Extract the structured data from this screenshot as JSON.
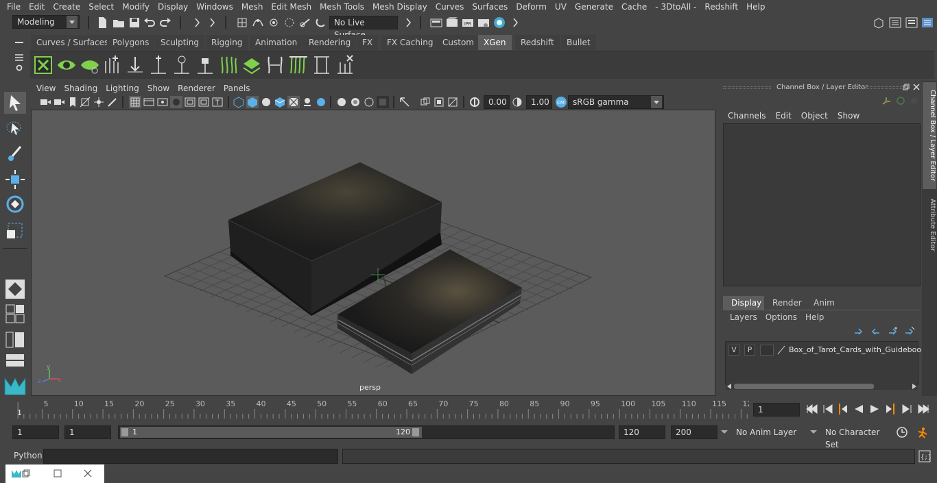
{
  "menubar": {
    "items": [
      "File",
      "Edit",
      "Create",
      "Select",
      "Modify",
      "Display",
      "Windows",
      "Mesh",
      "Edit Mesh",
      "Mesh Tools",
      "Mesh Display",
      "Curves",
      "Surfaces",
      "Deform",
      "UV",
      "Generate",
      "Cache",
      "- 3DtoAll -",
      "Redshift",
      "Help"
    ]
  },
  "status": {
    "mode": "Modeling",
    "live_surface": "No Live Surface"
  },
  "shelf": {
    "tabs": [
      "Curves / Surfaces",
      "Polygons",
      "Sculpting",
      "Rigging",
      "Animation",
      "Rendering",
      "FX",
      "FX Caching",
      "Custom",
      "XGen",
      "Redshift",
      "Bullet"
    ],
    "active_tab": "XGen"
  },
  "panel_menu": [
    "View",
    "Shading",
    "Lighting",
    "Show",
    "Renderer",
    "Panels"
  ],
  "view_tools": {
    "exposure": "0.00",
    "gamma": "1.00",
    "color_space": "sRGB gamma"
  },
  "viewport": {
    "camera_label": "persp",
    "axis_x": "x",
    "axis_y": "y",
    "axis_z": "z"
  },
  "channel_box": {
    "title": "Channel Box / Layer Editor",
    "menu": [
      "Channels",
      "Edit",
      "Object",
      "Show"
    ],
    "layer_tabs": [
      "Display",
      "Render",
      "Anim"
    ],
    "active_layer_tab": "Display",
    "layer_menu": [
      "Layers",
      "Options",
      "Help"
    ],
    "layer": {
      "v": "V",
      "p": "P",
      "name": "Box_of_Tarot_Cards_with_Guidebook"
    }
  },
  "side_tabs": [
    "Channel Box / Layer Editor",
    "Attribute Editor"
  ],
  "timeline": {
    "ticks": [
      "5",
      "10",
      "15",
      "20",
      "25",
      "30",
      "35",
      "40",
      "45",
      "50",
      "55",
      "60",
      "65",
      "70",
      "75",
      "80",
      "85",
      "90",
      "95",
      "100",
      "105",
      "110",
      "115",
      "12"
    ],
    "start_marker": "1",
    "current_frame": "1"
  },
  "range": {
    "start": "1",
    "anim_start": "1",
    "slider_start": "1",
    "slider_end": "120",
    "anim_end": "120",
    "end": "200",
    "anim_layer": "No Anim Layer",
    "character_set": "No Character Set"
  },
  "cmdline": {
    "label": "Python"
  },
  "colors": {
    "accent": "#5d5d5d",
    "bg": "#444444",
    "viewport": "#5b5b5b",
    "timeline_marker": "#ff8c00",
    "shelf_green": "#7fd14d"
  }
}
